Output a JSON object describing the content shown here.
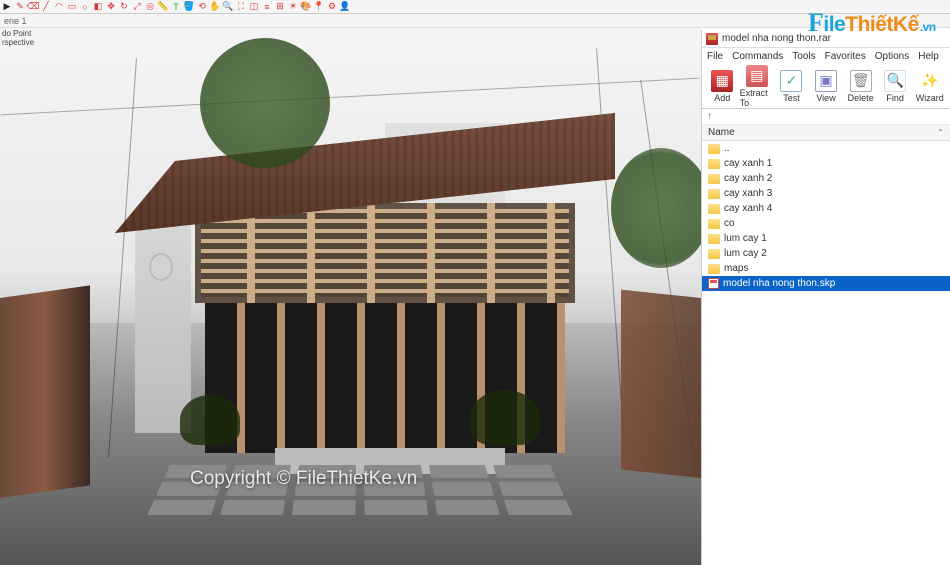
{
  "sketchup": {
    "top_tools_count": 28,
    "scene_tab": "ene 1",
    "viewport_label_line1": "do Point",
    "viewport_label_line2": "rspective"
  },
  "watermark": "Copyright © FileThietKe.vn",
  "brand": {
    "f": "F",
    "ile": "ile",
    "thiet": "Thiết",
    "ke": "Kế",
    "vn": ".vn"
  },
  "rar": {
    "title": "model nha nong thon.rar",
    "menu": [
      "File",
      "Commands",
      "Tools",
      "Favorites",
      "Options",
      "Help"
    ],
    "tools": [
      {
        "label": "Add",
        "cls": "ic-add",
        "glyph": "▦"
      },
      {
        "label": "Extract To",
        "cls": "ic-extract",
        "glyph": "▤"
      },
      {
        "label": "Test",
        "cls": "ic-test",
        "glyph": "✓"
      },
      {
        "label": "View",
        "cls": "ic-view",
        "glyph": "▣"
      },
      {
        "label": "Delete",
        "cls": "ic-delete",
        "glyph": "🗑"
      },
      {
        "label": "Find",
        "cls": "ic-find",
        "glyph": "🔍"
      },
      {
        "label": "Wizard",
        "cls": "ic-wizard",
        "glyph": "✨"
      }
    ],
    "path_up": "↑",
    "column_header": "Name",
    "files": [
      {
        "name": "..",
        "type": "folder"
      },
      {
        "name": "cay xanh 1",
        "type": "folder"
      },
      {
        "name": "cay xanh 2",
        "type": "folder"
      },
      {
        "name": "cay xanh 3",
        "type": "folder"
      },
      {
        "name": "cay xanh 4",
        "type": "folder"
      },
      {
        "name": "co",
        "type": "folder"
      },
      {
        "name": "lum cay 1",
        "type": "folder"
      },
      {
        "name": "lum cay 2",
        "type": "folder"
      },
      {
        "name": "maps",
        "type": "folder"
      },
      {
        "name": "model nha nong thon.skp",
        "type": "skp",
        "selected": true
      }
    ]
  }
}
